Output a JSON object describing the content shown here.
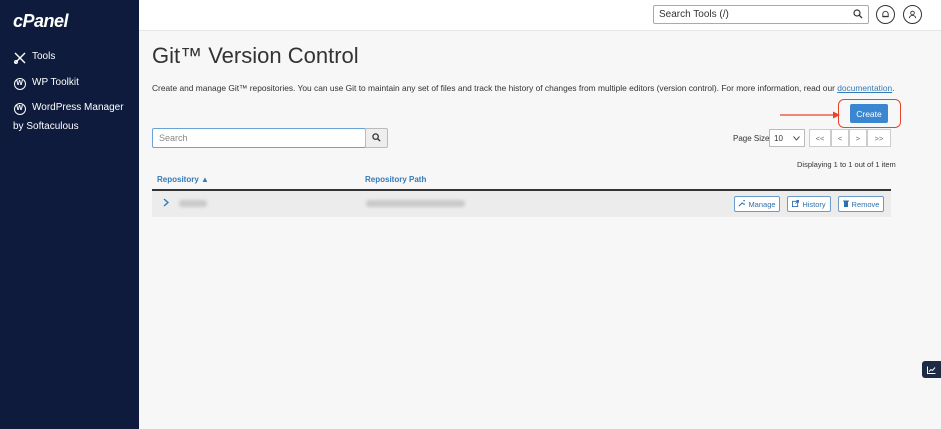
{
  "sidebar": {
    "logo": "cPanel",
    "items": [
      {
        "label": "Tools"
      },
      {
        "label": "WP Toolkit"
      },
      {
        "label_line1": "WordPress Manager",
        "label_line2": "by Softaculous"
      }
    ]
  },
  "topbar": {
    "search_text": "Search Tools (/)"
  },
  "page": {
    "title": "Git™ Version Control",
    "description": "Create and manage Git™ repositories. You can use Git to maintain any set of files and track the history of changes from multiple editors (version control). For more information, read our ",
    "doc_link": "documentation",
    "doc_suffix": ".",
    "create_label": "Create",
    "search_placeholder": "Search",
    "page_size_label": "Page Size",
    "page_size_value": "10",
    "pager": [
      "<<",
      "<",
      ">",
      ">>"
    ],
    "displaying": "Displaying 1 to 1 out of 1 item",
    "columns": [
      "Repository ▲",
      "Repository Path"
    ],
    "row_actions": [
      "Manage",
      "History",
      "Remove"
    ]
  },
  "colors": {
    "sidebar_bg": "#0f1b3d",
    "accent": "#3a86d0",
    "highlight": "#e8442b"
  }
}
